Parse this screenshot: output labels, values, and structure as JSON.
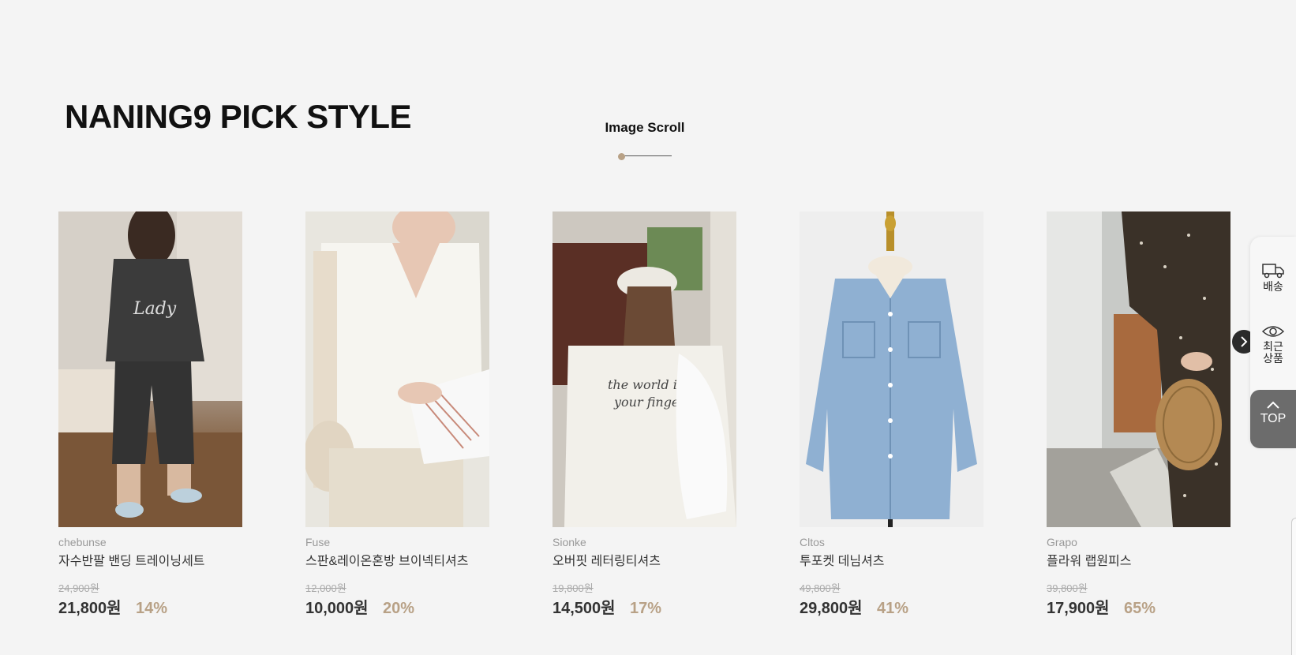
{
  "section": {
    "title": "NANING9 PICK STYLE",
    "scroll_label": "Image Scroll"
  },
  "products": [
    {
      "brand": "chebunse",
      "name": "자수반팔 밴딩 트레이닝세트",
      "original_price": "24,900원",
      "price": "21,800원",
      "discount": "14%"
    },
    {
      "brand": "Fuse",
      "name": "스판&레이온혼방 브이넥티셔츠",
      "original_price": "12,000원",
      "price": "10,000원",
      "discount": "20%"
    },
    {
      "brand": "Sionke",
      "name": "오버핏 레터링티셔츠",
      "original_price": "19,800원",
      "price": "14,500원",
      "discount": "17%"
    },
    {
      "brand": "Cltos",
      "name": "투포켓 데님셔츠",
      "original_price": "49,800원",
      "price": "29,800원",
      "discount": "41%"
    },
    {
      "brand": "Grapo",
      "name": "플라워 랩원피스",
      "original_price": "39,800원",
      "price": "17,900원",
      "discount": "65%"
    }
  ],
  "side_panel": {
    "delivery_label": "배송",
    "recent_label_line1": "최근",
    "recent_label_line2": "상품",
    "top_label": "TOP"
  },
  "colors": {
    "accent": "#b8a186",
    "background": "#f4f4f4",
    "top_button": "#6c6c6c"
  },
  "icons": [
    "truck-icon",
    "eye-icon",
    "chevron-up-icon",
    "chevron-right-icon"
  ]
}
